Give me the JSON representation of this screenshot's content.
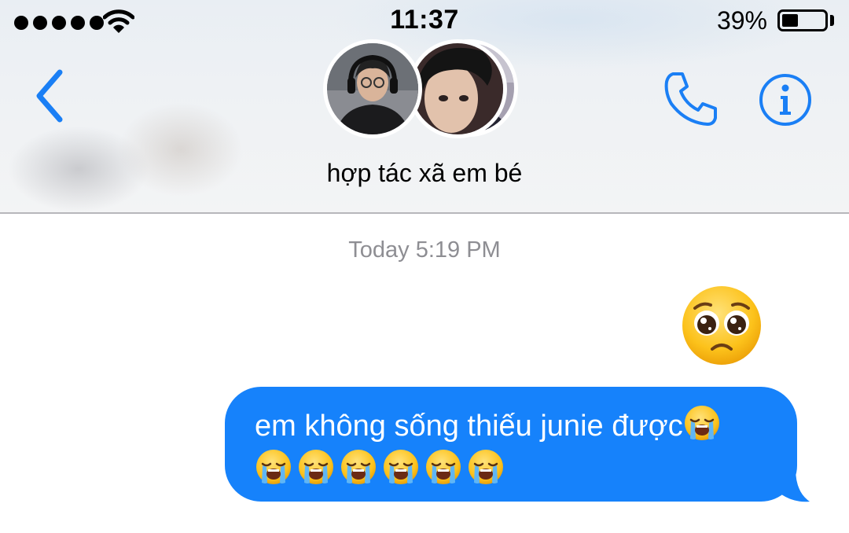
{
  "status_bar": {
    "time": "11:37",
    "battery_percent": "39%",
    "battery_level": 0.39,
    "signal_bars": 5
  },
  "header": {
    "group_name": "hợp tác xã em bé",
    "back_icon": "chevron-left-icon",
    "call_icon": "phone-icon",
    "info_icon": "info-icon"
  },
  "conversation": {
    "timestamp": "Today 5:19 PM",
    "messages": [
      {
        "type": "emoji",
        "emoji": "pleading-face"
      },
      {
        "type": "text",
        "text": "em không sống thiếu junie được",
        "trailing_emoji": "loudly-crying-face",
        "emoji_row_count": 6
      }
    ]
  },
  "colors": {
    "accent": "#1682fb",
    "bubble": "#1682fb",
    "timestamp": "#8e8e93",
    "icon_blue": "#1a7ff5"
  }
}
